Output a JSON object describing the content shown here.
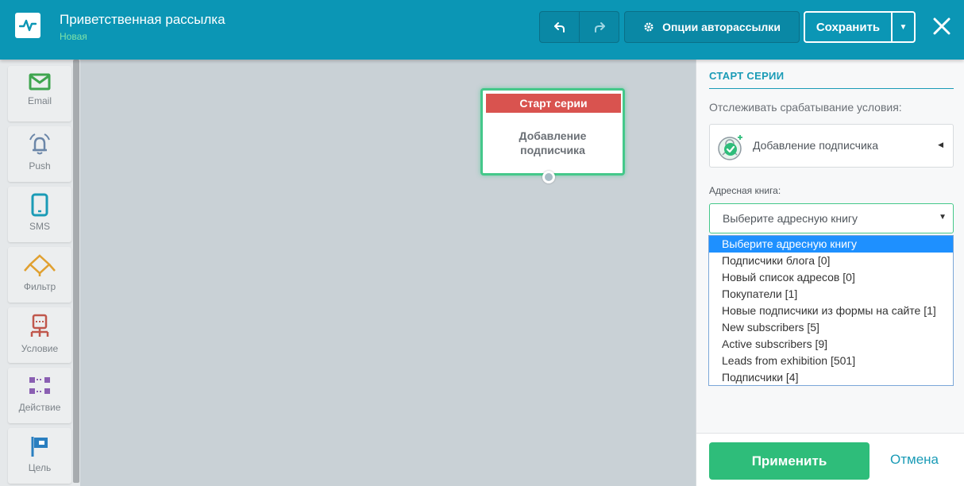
{
  "header": {
    "title": "Приветственная рассылка",
    "status": "Новая",
    "options_label": "Опции авторассылки",
    "save_label": "Сохранить"
  },
  "palette": {
    "items": [
      {
        "label": "Email",
        "icon": "envelope-icon",
        "color": "#3fa54f"
      },
      {
        "label": "Push",
        "icon": "bell-icon",
        "color": "#6b86a8"
      },
      {
        "label": "SMS",
        "icon": "mobile-icon",
        "color": "#1a9bb6"
      },
      {
        "label": "Фильтр",
        "icon": "filter-icon",
        "color": "#e0a030"
      },
      {
        "label": "Условие",
        "icon": "condition-icon",
        "color": "#c0574c"
      },
      {
        "label": "Действие",
        "icon": "action-icon",
        "color": "#8a5fb2"
      },
      {
        "label": "Цель",
        "icon": "flag-icon",
        "color": "#2a7fc0"
      }
    ]
  },
  "canvas": {
    "node": {
      "header": "Старт серии",
      "body_line1": "Добавление",
      "body_line2": "подписчика"
    }
  },
  "panel": {
    "title": "СТАРТ СЕРИИ",
    "track_label": "Отслеживать срабатывание условия:",
    "trigger": "Добавление подписчика",
    "book_label": "Адресная книга:",
    "book_placeholder": "Выберите адресную книгу",
    "options": [
      "Выберите адресную книгу",
      "Подписчики блога [0]",
      "Новый список адресов [0]",
      "Покупатели [1]",
      "Новые подписчики из формы на сайте [1]",
      "New subscribers [5]",
      "Active subscribers [9]",
      "Leads from exhibition [501]",
      "Подписчики [4]"
    ],
    "selected_index": 0,
    "apply_label": "Применить",
    "cancel_label": "Отмена"
  },
  "colors": {
    "header_bg": "#0b96b5",
    "accent_green": "#2ebd7a",
    "node_header_red": "#d9534f",
    "link_teal": "#1a9bb6"
  }
}
